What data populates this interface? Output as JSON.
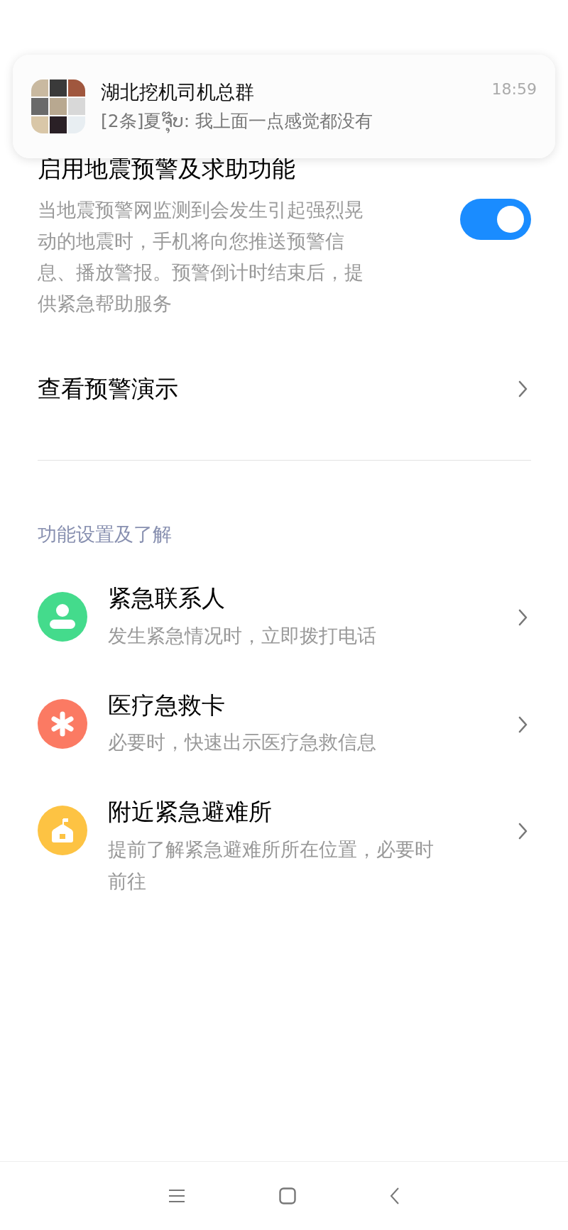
{
  "notification": {
    "title": "湖北挖机司机总群",
    "message": "[2条]夏ຈຸ໊ບ: 我上面一点感觉都没有",
    "time": "18:59"
  },
  "main_setting": {
    "title": "启用地震预警及求助功能",
    "description": "当地震预警网监测到会发生引起强烈晃动的地震时，手机将向您推送预警信息、播放警报。预警倒计时结束后，提供紧急帮助服务",
    "on": true
  },
  "demo_link": {
    "label": "查看预警演示"
  },
  "section_title": "功能设置及了解",
  "items": [
    {
      "kind": "contact",
      "title": "紧急联系人",
      "subtitle": "发生紧急情况时，立即拨打电话",
      "color": "#44db8c"
    },
    {
      "kind": "medical",
      "title": "医疗急救卡",
      "subtitle": "必要时，快速出示医疗急救信息",
      "color": "#fb7a63"
    },
    {
      "kind": "shelter",
      "title": "附近紧急避难所",
      "subtitle": "提前了解紧急避难所所在位置，必要时前往",
      "color": "#fdc343"
    }
  ],
  "nav_bar": [
    {
      "kind": "menu"
    },
    {
      "kind": "home"
    },
    {
      "kind": "back"
    }
  ]
}
